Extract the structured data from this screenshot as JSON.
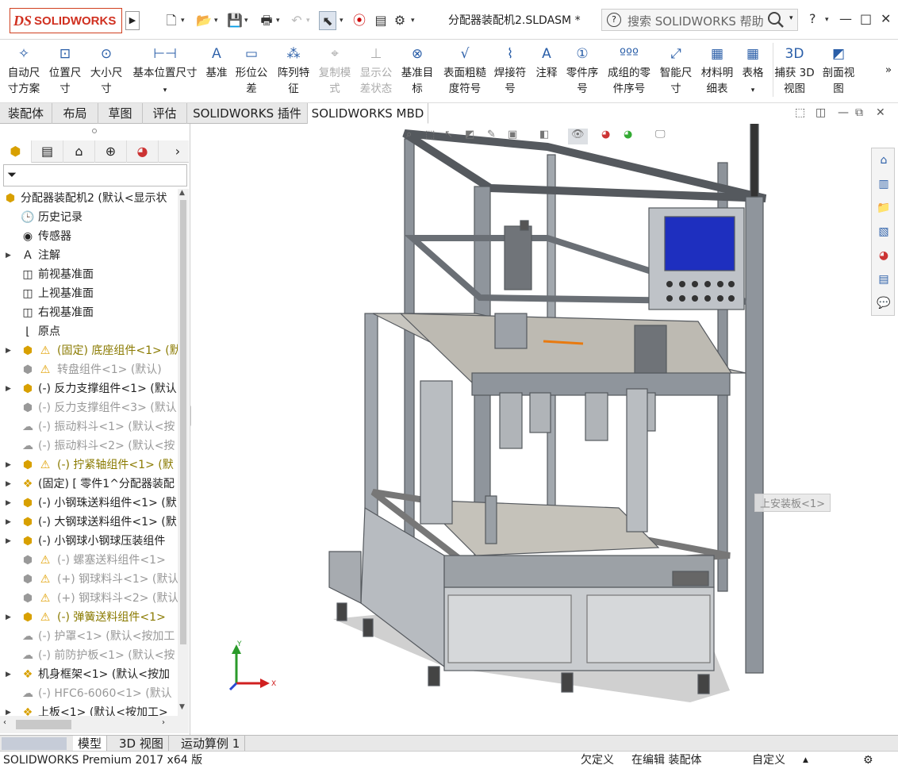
{
  "app": {
    "logo_ds": "𝔇𝔖",
    "logo_text": "SOLIDWORKS",
    "expander": "▶",
    "document_title": "分配器装配机2.SLDASM *"
  },
  "help": {
    "placeholder": "搜索 SOLIDWORKS 帮助",
    "q": "?"
  },
  "window": {
    "help": "?",
    "minimize": "—",
    "maximize": "□",
    "close": "✕"
  },
  "ribbon": {
    "items": [
      {
        "label": "自动尺寸方案",
        "icon": "auto-dimension-icon"
      },
      {
        "label": "位置尺寸",
        "icon": "location-dimension-icon"
      },
      {
        "label": "大小尺寸",
        "icon": "size-dimension-icon"
      },
      {
        "label": "基本位置尺寸",
        "icon": "basic-location-icon"
      },
      {
        "label": "基准",
        "icon": "datum-icon"
      },
      {
        "label": "形位公差",
        "icon": "geometric-tolerance-icon"
      },
      {
        "label": "阵列特征",
        "icon": "pattern-feature-icon"
      },
      {
        "label": "复制模式",
        "icon": "copy-scheme-icon",
        "disabled": true
      },
      {
        "label": "显示公差状态",
        "icon": "tolerance-status-icon",
        "disabled": true
      },
      {
        "label": "基准目标",
        "icon": "datum-target-icon"
      },
      {
        "label": "表面粗糙度符号",
        "icon": "surface-finish-icon"
      },
      {
        "label": "焊接符号",
        "icon": "weld-symbol-icon"
      },
      {
        "label": "注释",
        "icon": "note-icon"
      },
      {
        "label": "零件序号",
        "icon": "balloon-icon"
      },
      {
        "label": "成组的零件序号",
        "icon": "stacked-balloon-icon"
      },
      {
        "label": "智能尺寸",
        "icon": "smart-dimension-icon"
      },
      {
        "label": "材料明细表",
        "icon": "bom-icon"
      },
      {
        "label": "表格",
        "icon": "table-icon"
      },
      {
        "label": "捕获 3D 视图",
        "icon": "capture-3d-view-icon"
      },
      {
        "label": "剖面视图",
        "icon": "section-view-icon"
      }
    ]
  },
  "tabs": [
    "装配体",
    "布局",
    "草图",
    "评估",
    "SOLIDWORKS 插件",
    "SOLIDWORKS MBD"
  ],
  "tree": {
    "root": "分配器装配机2 (默认<显示状",
    "items": [
      {
        "label": "历史记录",
        "icon": "history-icon"
      },
      {
        "label": "传感器",
        "icon": "sensor-icon"
      },
      {
        "label": "注解",
        "icon": "annotation-icon"
      },
      {
        "label": "前视基准面",
        "icon": "plane-icon"
      },
      {
        "label": "上视基准面",
        "icon": "plane-icon"
      },
      {
        "label": "右视基准面",
        "icon": "plane-icon"
      },
      {
        "label": "原点",
        "icon": "origin-icon"
      },
      {
        "label": "(固定) 底座组件<1> (默",
        "icon": "assembly-icon"
      },
      {
        "label": "转盘组件<1> (默认)",
        "icon": "assembly-icon"
      },
      {
        "label": "(-) 反力支撑组件<1> (默认",
        "icon": "assembly-icon"
      },
      {
        "label": "(-) 反力支撑组件<3> (默认",
        "icon": "assembly-icon"
      },
      {
        "label": "(-) 振动料斗<1> (默认<按",
        "icon": "part-icon"
      },
      {
        "label": "(-) 振动料斗<2> (默认<按",
        "icon": "part-icon"
      },
      {
        "label": "(-) 拧紧轴组件<1> (默",
        "icon": "assembly-icon"
      },
      {
        "label": "(固定) [ 零件1^分配器装配",
        "icon": "part-icon"
      },
      {
        "label": "(-) 小钢珠送料组件<1> (默",
        "icon": "assembly-icon"
      },
      {
        "label": "(-) 大钢球送料组件<1> (默",
        "icon": "assembly-icon"
      },
      {
        "label": "(-) 小钢球小钢球压装组件",
        "icon": "assembly-icon"
      },
      {
        "label": "(-) 螺塞送料组件<1>",
        "icon": "assembly-icon"
      },
      {
        "label": "(+) 钢球料斗<1> (默认",
        "icon": "assembly-icon"
      },
      {
        "label": "(+) 钢球料斗<2> (默认",
        "icon": "assembly-icon"
      },
      {
        "label": "(-) 弹簧送料组件<1>",
        "icon": "assembly-icon"
      },
      {
        "label": "(-) 护罩<1> (默认<按加工",
        "icon": "part-icon"
      },
      {
        "label": "(-) 前防护板<1> (默认<按",
        "icon": "part-icon"
      },
      {
        "label": "机身框架<1> (默认<按加",
        "icon": "assembly-icon"
      },
      {
        "label": "(-) HFC6-6060<1> (默认",
        "icon": "part-icon"
      },
      {
        "label": "上板<1> (默认<按加工>",
        "icon": "part-icon"
      }
    ]
  },
  "viewport": {
    "annotation_label": "上安装板<1>",
    "axis_x": "X",
    "axis_y": "Y"
  },
  "bottom_tabs": [
    "模型",
    "3D 视图",
    "运动算例 1"
  ],
  "status": {
    "product": "SOLIDWORKS Premium 2017 x64 版",
    "state1": "欠定义",
    "state2": "在编辑 装配体",
    "state3": "自定义"
  },
  "colors": {
    "brand": "#d03020",
    "icon_blue": "#2a5ea8",
    "warn": "#e0a000",
    "frame": "#8a8f96",
    "screen": "#1e2fbf"
  }
}
